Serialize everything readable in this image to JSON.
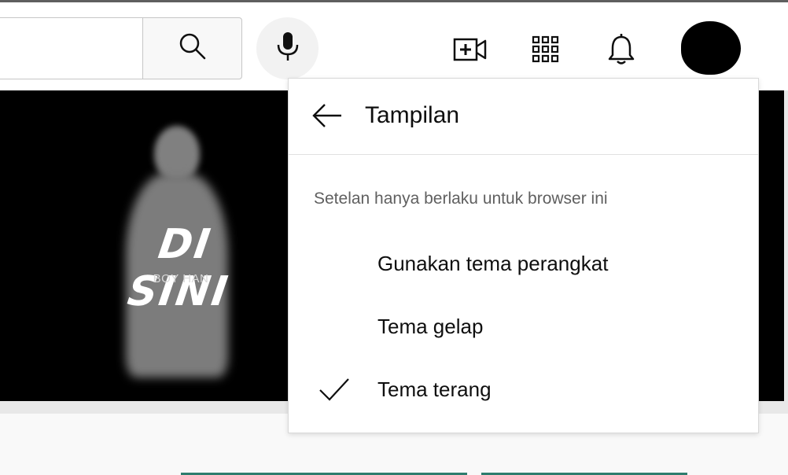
{
  "search": {
    "value": "",
    "placeholder": "",
    "button_icon": "search-icon"
  },
  "header": {
    "icons": [
      "search-icon",
      "microphone-icon",
      "create-video-icon",
      "apps-grid-icon",
      "bell-icon"
    ],
    "avatar": "avatar"
  },
  "banner": {
    "title": "DI SINI",
    "subtitle": "BOY HAN",
    "background": "#000000"
  },
  "appearance_menu": {
    "back_icon": "arrow-left-icon",
    "title": "Tampilan",
    "subtitle": "Setelan hanya berlaku untuk browser ini",
    "options": [
      {
        "label": "Gunakan tema perangkat",
        "selected": false
      },
      {
        "label": "Tema gelap",
        "selected": false
      },
      {
        "label": "Tema terang",
        "selected": true
      }
    ],
    "check_icon": "checkmark-icon"
  },
  "colors": {
    "accent_strip": "#2e7d6e",
    "text_primary": "#0f0f0f",
    "text_secondary": "#606060"
  }
}
